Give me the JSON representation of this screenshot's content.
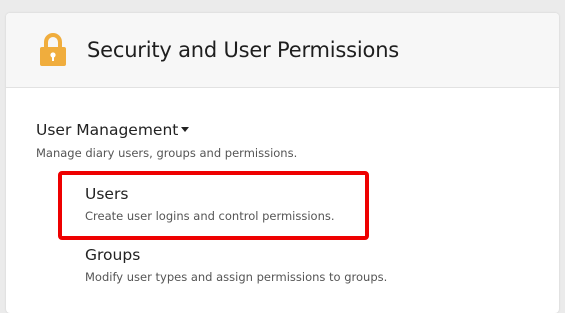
{
  "header": {
    "title": "Security and User Permissions",
    "icon": "lock-icon",
    "icon_color": "#f0ad3d"
  },
  "section": {
    "title": "User Management",
    "description": "Manage diary users, groups and permissions."
  },
  "items": [
    {
      "label": "Users",
      "description": "Create user logins and control permissions."
    },
    {
      "label": "Groups",
      "description": "Modify user types and assign permissions to groups."
    }
  ],
  "highlight_color": "#ee0000"
}
